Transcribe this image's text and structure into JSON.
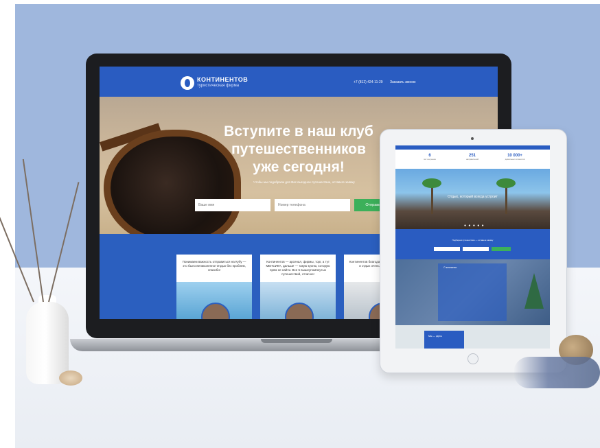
{
  "laptop_site": {
    "brand_name": "КОНТИНЕНТОВ",
    "brand_sub": "туристическая фирма",
    "phone": "+7 (812) 424-11-29",
    "callback_label": "Заказать звонок",
    "hero_title": "Вступите в наш клуб путешественников уже сегодня!",
    "hero_sub": "Чтобы мы подобрали для Вас выгодное путешествие, оставьте заявку",
    "name_placeholder": "Ваше имя",
    "phone_placeholder": "Номер телефона",
    "submit_label": "Отправить",
    "cards": [
      {
        "text": "Понимаем важность отправиться на Кубу — это было великолепно! Отдых без проблем, спасибо!"
      },
      {
        "text": "Континентов — арсенал, фирмы, торг, а тут МЕНСИКА, дальше — такую кухню, которую прям не найти. Все 5 вышеупомянутых путешествий, отлично!"
      },
      {
        "text": "Континентов благодарим за фирму — отдых, и отдых очень высокого уровня"
      }
    ]
  },
  "tablet_site": {
    "stats": [
      {
        "num": "6",
        "label": "лет на рынке"
      },
      {
        "num": "251",
        "label": "направлений"
      },
      {
        "num": "10 000+",
        "label": "довольных клиентов"
      }
    ],
    "slider_title": "Отдых, который всегда устроит",
    "slider_dots": "● ● ● ● ●",
    "form_text": "Подберем путешествие — оставьте заявку",
    "office_title": "О компании",
    "map_label": "Мы — здесь"
  }
}
